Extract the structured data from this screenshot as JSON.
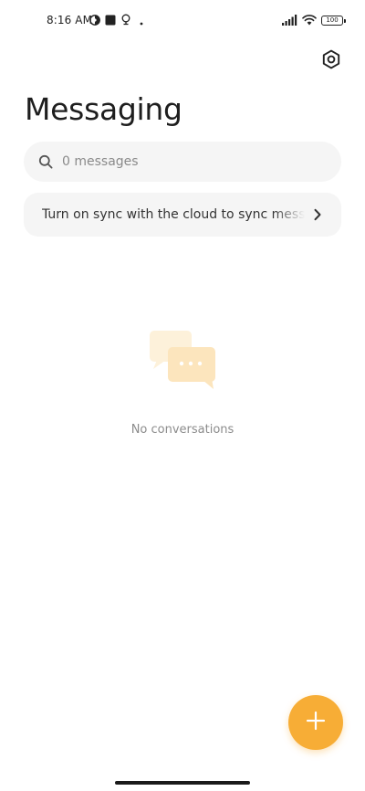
{
  "status_bar": {
    "time": "8:16 AM",
    "battery": "100",
    "icons_left": [
      "app-notification-icon",
      "square-notification-icon",
      "bulb-notification-icon",
      "dot-icon"
    ],
    "icons_right": [
      "signal-icon",
      "wifi-icon",
      "battery-icon"
    ]
  },
  "header": {
    "title": "Messaging",
    "settings_icon": "gear-icon"
  },
  "search": {
    "placeholder": "0 messages",
    "value": ""
  },
  "sync_banner": {
    "text": "Turn on sync with the cloud to sync messages"
  },
  "empty_state": {
    "illustration": "chat-bubbles-icon",
    "text": "No conversations"
  },
  "fab": {
    "icon": "plus-icon"
  },
  "colors": {
    "accent": "#f7ad36",
    "surface": "#f5f5f5",
    "text_primary": "#1e1e1e",
    "text_muted": "#8c8c8c"
  }
}
